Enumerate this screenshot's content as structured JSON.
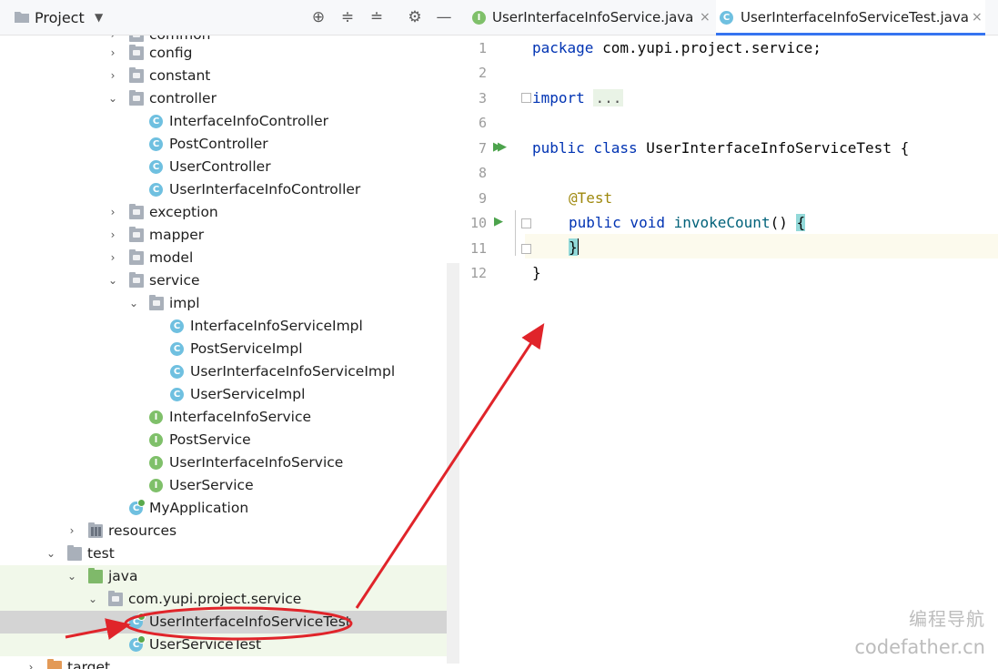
{
  "project_panel": {
    "title": "Project",
    "toolbar_icons": [
      "target-icon",
      "expand-all-icon",
      "collapse-all-icon",
      "gear-icon",
      "minimize-icon"
    ]
  },
  "tree": [
    {
      "label": "common",
      "type": "package",
      "expanded": false
    },
    {
      "label": "config",
      "type": "package",
      "expanded": false
    },
    {
      "label": "constant",
      "type": "package",
      "expanded": false
    },
    {
      "label": "controller",
      "type": "package",
      "expanded": true
    },
    {
      "label": "InterfaceInfoController",
      "type": "class"
    },
    {
      "label": "PostController",
      "type": "class"
    },
    {
      "label": "UserController",
      "type": "class"
    },
    {
      "label": "UserInterfaceInfoController",
      "type": "class"
    },
    {
      "label": "exception",
      "type": "package",
      "expanded": false
    },
    {
      "label": "mapper",
      "type": "package",
      "expanded": false
    },
    {
      "label": "model",
      "type": "package",
      "expanded": false
    },
    {
      "label": "service",
      "type": "package",
      "expanded": true
    },
    {
      "label": "impl",
      "type": "package",
      "expanded": true
    },
    {
      "label": "InterfaceInfoServiceImpl",
      "type": "class"
    },
    {
      "label": "PostServiceImpl",
      "type": "class"
    },
    {
      "label": "UserInterfaceInfoServiceImpl",
      "type": "class"
    },
    {
      "label": "UserServiceImpl",
      "type": "class"
    },
    {
      "label": "InterfaceInfoService",
      "type": "interface"
    },
    {
      "label": "PostService",
      "type": "interface"
    },
    {
      "label": "UserInterfaceInfoService",
      "type": "interface"
    },
    {
      "label": "UserService",
      "type": "interface"
    },
    {
      "label": "MyApplication",
      "type": "app-class"
    },
    {
      "label": "resources",
      "type": "resources",
      "expanded": false
    },
    {
      "label": "test",
      "type": "folder",
      "expanded": true
    },
    {
      "label": "java",
      "type": "test-root",
      "expanded": true
    },
    {
      "label": "com.yupi.project.service",
      "type": "package",
      "expanded": true
    },
    {
      "label": "UserInterfaceInfoServiceTest",
      "type": "test-class",
      "selected": true
    },
    {
      "label": "UserServiceTest",
      "type": "test-class"
    },
    {
      "label": "target",
      "type": "excluded",
      "expanded": false
    }
  ],
  "tabs": [
    {
      "label": "UserInterfaceInfoService.java",
      "icon": "interface-icon",
      "active": false,
      "close": "×"
    },
    {
      "label": "UserInterfaceInfoServiceTest.java",
      "icon": "test-class-icon",
      "active": true,
      "close": "×"
    }
  ],
  "editor": {
    "line_numbers": [
      "1",
      "2",
      "3",
      "6",
      "7",
      "8",
      "9",
      "10",
      "11",
      "12"
    ],
    "code": {
      "l1_kw": "package",
      "l1_rest": " com.yupi.project.service;",
      "l3_kw": "import",
      "l3_dots": "...",
      "l7_kw": "public class",
      "l7_rest": " UserInterfaceInfoServiceTest {",
      "l9_ann": "@Test",
      "l10_kw": "public void",
      "l10_fn": "invokeCount",
      "l10_parens": "() ",
      "l10_brace": "{",
      "l11_brace": "}",
      "l12_brace": "}"
    }
  },
  "watermark": {
    "line1": "编程导航",
    "line2": "codefather.cn"
  },
  "colors": {
    "keyword": "#0033b3",
    "annotation": "#9e880d",
    "method": "#00627a",
    "annotation_arrow": "#e0242a",
    "active_tab_underline": "#3574f0"
  }
}
